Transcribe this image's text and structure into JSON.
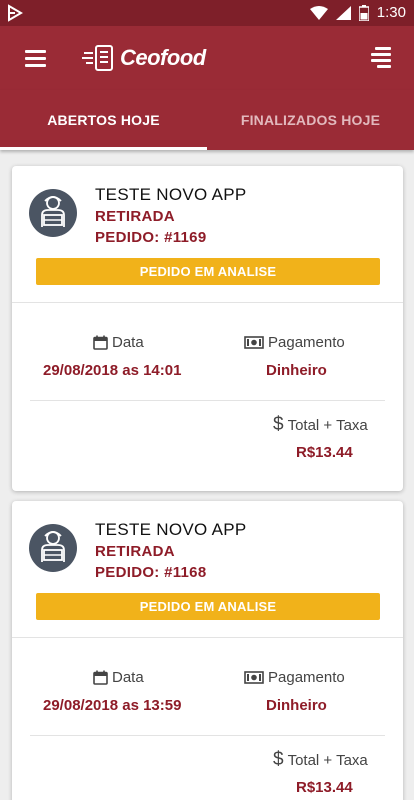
{
  "status_bar": {
    "time": "1:30"
  },
  "app_bar": {
    "logo_text": "Ceofood"
  },
  "tabs": [
    {
      "label": "ABERTOS HOJE",
      "active": true
    },
    {
      "label": "FINALIZADOS HOJE",
      "active": false
    }
  ],
  "labels": {
    "data": "Data",
    "pagamento": "Pagamento",
    "total": "Total + Taxa"
  },
  "orders": [
    {
      "customer": "TESTE NOVO APP",
      "type": "RETIRADA",
      "order_number": "PEDIDO: #1169",
      "status": "PEDIDO EM ANALISE",
      "date": "29/08/2018 as 14:01",
      "payment": "Dinheiro",
      "total": "R$13.44"
    },
    {
      "customer": "TESTE NOVO APP",
      "type": "RETIRADA",
      "order_number": "PEDIDO: #1168",
      "status": "PEDIDO EM ANALISE",
      "date": "29/08/2018 as 13:59",
      "payment": "Dinheiro",
      "total": "R$13.44"
    }
  ],
  "colors": {
    "primary": "#9a2b36",
    "status_bar": "#7e1f29",
    "accent_text": "#8e1c28",
    "status_button": "#f1b21a"
  },
  "icons": [
    "menu-icon",
    "filter-icon",
    "calendar-icon",
    "money-icon",
    "dollar-icon",
    "avatar-icon"
  ]
}
